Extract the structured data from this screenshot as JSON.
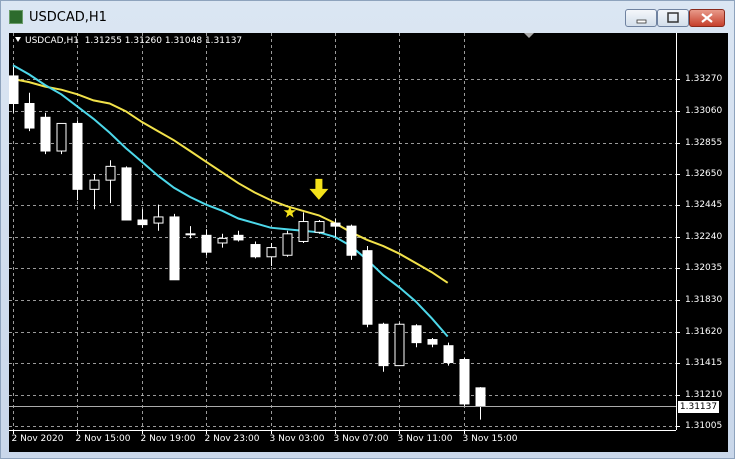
{
  "window": {
    "title": "USDCAD,H1"
  },
  "colors": {
    "background": "#000000",
    "grid": "#c0c0c0",
    "ema_fast": "#4dd8ea",
    "ema_slow": "#f2e24a",
    "marker": "#f4e21a"
  },
  "icons": {
    "app": "mt4-chart-icon",
    "minimize": "minimize-icon",
    "maximize": "maximize-icon",
    "close": "close-icon"
  },
  "chart_info": {
    "symbol": "USDCAD,H1",
    "ohlc": "1.31255 1.31260 1.31048 1.31137"
  },
  "current_price": "1.31137",
  "chart_data": {
    "type": "candlestick",
    "title": "USDCAD,H1",
    "x_tick_labels": [
      "2 Nov 2020",
      "2 Nov 15:00",
      "2 Nov 19:00",
      "2 Nov 23:00",
      "3 Nov 03:00",
      "3 Nov 07:00",
      "3 Nov 11:00",
      "3 Nov 15:00"
    ],
    "y_tick_labels": [
      "1.33270",
      "1.33060",
      "1.32855",
      "1.32650",
      "1.32445",
      "1.32240",
      "1.32035",
      "1.31830",
      "1.31620",
      "1.31415",
      "1.31210",
      "1.31005"
    ],
    "ylim": [
      1.3098,
      1.3357
    ],
    "candles": [
      {
        "o": 1.3329,
        "h": 1.3335,
        "l": 1.3305,
        "c": 1.3311
      },
      {
        "o": 1.3311,
        "h": 1.3318,
        "l": 1.3293,
        "c": 1.3295
      },
      {
        "o": 1.3302,
        "h": 1.3305,
        "l": 1.3278,
        "c": 1.328
      },
      {
        "o": 1.328,
        "h": 1.3298,
        "l": 1.3278,
        "c": 1.3298
      },
      {
        "o": 1.3298,
        "h": 1.33,
        "l": 1.3248,
        "c": 1.3255
      },
      {
        "o": 1.3255,
        "h": 1.3265,
        "l": 1.3242,
        "c": 1.3261
      },
      {
        "o": 1.3261,
        "h": 1.3274,
        "l": 1.3246,
        "c": 1.327
      },
      {
        "o": 1.3269,
        "h": 1.327,
        "l": 1.3235,
        "c": 1.3235
      },
      {
        "o": 1.3235,
        "h": 1.3242,
        "l": 1.323,
        "c": 1.3232
      },
      {
        "o": 1.3233,
        "h": 1.3245,
        "l": 1.3228,
        "c": 1.3237
      },
      {
        "o": 1.3237,
        "h": 1.3239,
        "l": 1.322,
        "c": 1.3196
      },
      {
        "o": 1.3226,
        "h": 1.3231,
        "l": 1.3223,
        "c": 1.3226
      },
      {
        "o": 1.3225,
        "h": 1.3229,
        "l": 1.3212,
        "c": 1.3214
      },
      {
        "o": 1.322,
        "h": 1.3226,
        "l": 1.3217,
        "c": 1.3223
      },
      {
        "o": 1.3225,
        "h": 1.3228,
        "l": 1.3221,
        "c": 1.3222
      },
      {
        "o": 1.3219,
        "h": 1.3221,
        "l": 1.321,
        "c": 1.3211
      },
      {
        "o": 1.3211,
        "h": 1.322,
        "l": 1.3205,
        "c": 1.3217
      },
      {
        "o": 1.3212,
        "h": 1.3228,
        "l": 1.3211,
        "c": 1.3226
      },
      {
        "o": 1.3221,
        "h": 1.324,
        "l": 1.322,
        "c": 1.3234
      },
      {
        "o": 1.3227,
        "h": 1.3235,
        "l": 1.3226,
        "c": 1.3234
      },
      {
        "o": 1.3233,
        "h": 1.3236,
        "l": 1.3224,
        "c": 1.3231
      },
      {
        "o": 1.3231,
        "h": 1.3232,
        "l": 1.3209,
        "c": 1.3212
      },
      {
        "o": 1.3215,
        "h": 1.3218,
        "l": 1.3165,
        "c": 1.3167
      },
      {
        "o": 1.3167,
        "h": 1.3168,
        "l": 1.3136,
        "c": 1.314
      },
      {
        "o": 1.314,
        "h": 1.3168,
        "l": 1.314,
        "c": 1.3167
      },
      {
        "o": 1.3166,
        "h": 1.3167,
        "l": 1.3152,
        "c": 1.3155
      },
      {
        "o": 1.3157,
        "h": 1.3158,
        "l": 1.3152,
        "c": 1.3154
      },
      {
        "o": 1.3153,
        "h": 1.3155,
        "l": 1.314,
        "c": 1.3142
      },
      {
        "o": 1.3144,
        "h": 1.3145,
        "l": 1.3113,
        "c": 1.3115
      },
      {
        "o": 1.31255,
        "h": 1.3126,
        "l": 1.31048,
        "c": 1.31137
      }
    ],
    "moving_averages": [
      {
        "color": "#f2e24a",
        "values": [
          1.3327,
          1.3325,
          1.3322,
          1.332,
          1.3317,
          1.3313,
          1.3311,
          1.3306,
          1.3299,
          1.3293,
          1.3287,
          1.328,
          1.3273,
          1.3266,
          1.3259,
          1.3253,
          1.3248,
          1.3244,
          1.3241,
          1.3238,
          1.3233,
          1.3227,
          1.3222,
          1.3218,
          1.3213,
          1.3207,
          1.3201,
          1.3194
        ]
      },
      {
        "color": "#4dd8ea",
        "values": [
          1.3336,
          1.333,
          1.3323,
          1.3317,
          1.3309,
          1.3301,
          1.3292,
          1.3282,
          1.3273,
          1.3264,
          1.3256,
          1.325,
          1.3245,
          1.3241,
          1.3236,
          1.3233,
          1.323,
          1.3229,
          1.3228,
          1.3227,
          1.3224,
          1.3218,
          1.3209,
          1.3199,
          1.3191,
          1.3182,
          1.3171,
          1.3159
        ]
      }
    ],
    "grid": true
  }
}
